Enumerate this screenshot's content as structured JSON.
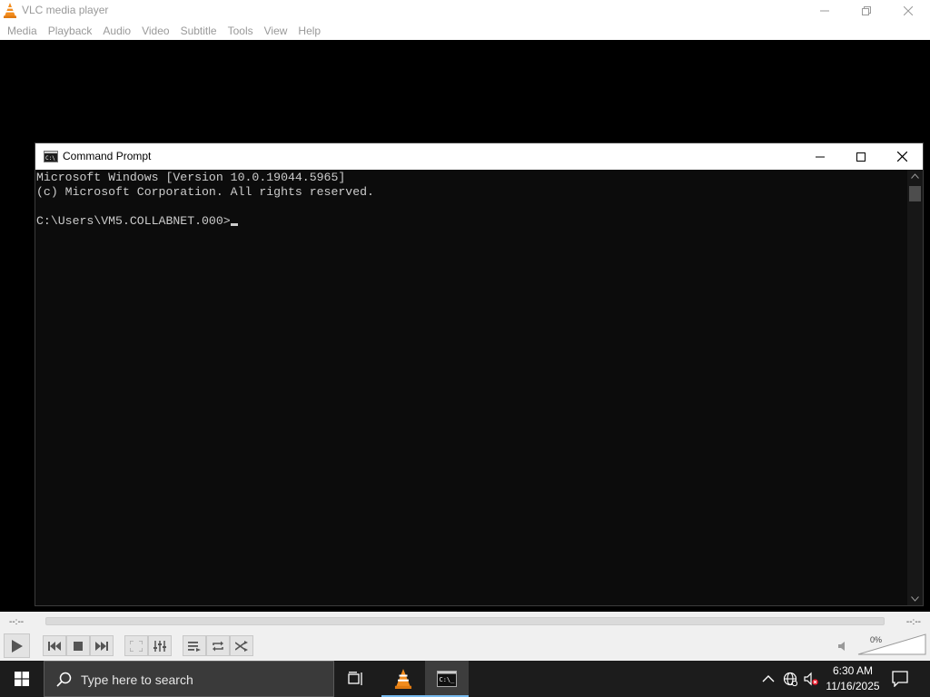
{
  "vlc": {
    "title": "VLC media player",
    "menu": [
      "Media",
      "Playback",
      "Audio",
      "Video",
      "Subtitle",
      "Tools",
      "View",
      "Help"
    ],
    "time_elapsed": "--:--",
    "time_total": "--:--",
    "volume": "0%"
  },
  "cmd": {
    "title": "Command Prompt",
    "lines": [
      "Microsoft Windows [Version 10.0.19044.5965]",
      "(c) Microsoft Corporation. All rights reserved.",
      "",
      "C:\\Users\\VM5.COLLABNET.000>"
    ]
  },
  "taskbar": {
    "search_placeholder": "Type here to search",
    "time": "6:30 AM",
    "date": "11/16/2025",
    "accent_color": "#76b9ed"
  }
}
